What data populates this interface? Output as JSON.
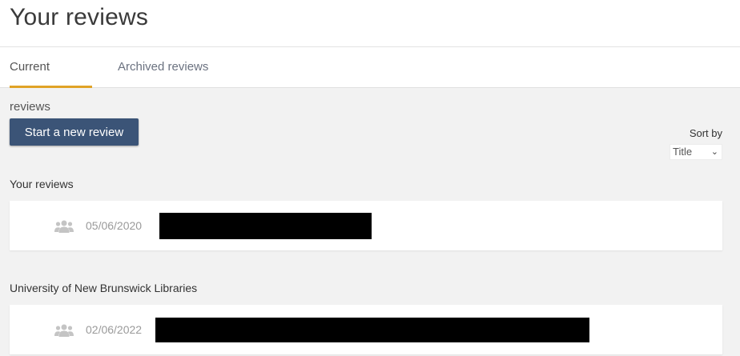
{
  "page": {
    "title": "Your reviews"
  },
  "tabs": [
    {
      "label": "Current reviews",
      "active": true
    },
    {
      "label": "Archived reviews",
      "active": false
    }
  ],
  "actions": {
    "new_review_label": "Start a new review"
  },
  "sort": {
    "label": "Sort by",
    "selected": "Title"
  },
  "groups": [
    {
      "title": "Your reviews",
      "reviews": [
        {
          "date": "05/06/2020",
          "icon": "people-icon"
        }
      ]
    },
    {
      "title": "University of New Brunswick Libraries",
      "reviews": [
        {
          "date": "02/06/2022",
          "icon": "people-icon"
        }
      ]
    }
  ],
  "colors": {
    "accent_underline": "#e0a326",
    "primary_button": "#3b5477",
    "background": "#f2f2f2"
  }
}
